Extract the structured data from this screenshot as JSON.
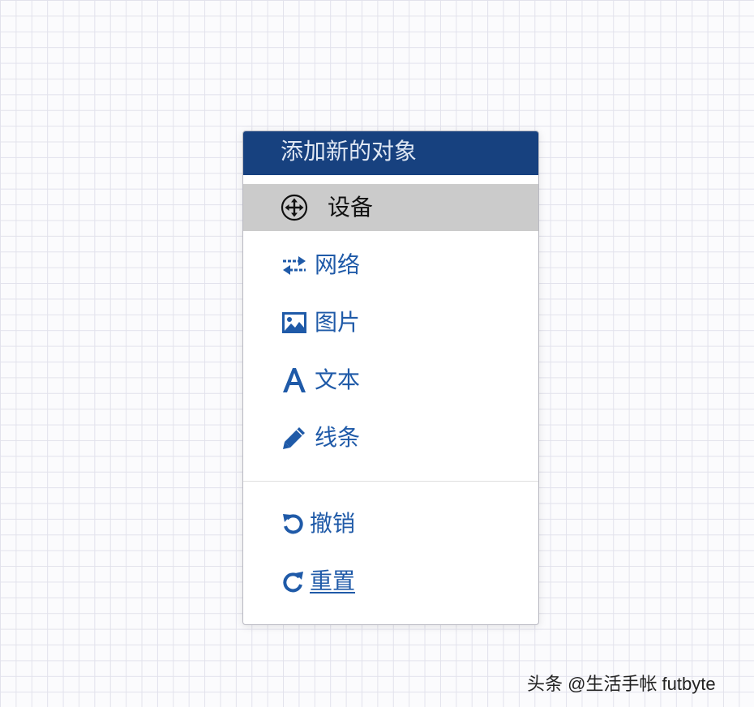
{
  "menu": {
    "title": "添加新的对象",
    "items": [
      {
        "label": "设备",
        "icon": "move-arrows-icon",
        "active": true
      },
      {
        "label": "网络",
        "icon": "swap-arrows-icon"
      },
      {
        "label": "图片",
        "icon": "image-icon"
      },
      {
        "label": "文本",
        "icon": "text-a-icon"
      },
      {
        "label": "线条",
        "icon": "pencil-icon"
      },
      {
        "label": "撤销",
        "icon": "undo-icon"
      },
      {
        "label": "重置",
        "icon": "redo-icon"
      }
    ]
  },
  "watermark": "头条 @生活手帐 futbyte",
  "colors": {
    "header": "#17417f",
    "active_item": "#cbcbcb",
    "link_blue": "#1f5aa8"
  }
}
